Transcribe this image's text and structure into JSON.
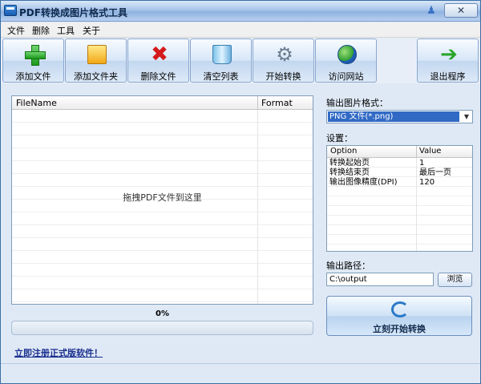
{
  "window": {
    "title": "PDF转换成图片格式工具",
    "close_label": "✕"
  },
  "menu": [
    {
      "label": "文件"
    },
    {
      "label": "删除"
    },
    {
      "label": "工具"
    },
    {
      "label": "关于"
    }
  ],
  "toolbar": {
    "add_file": "添加文件",
    "add_folder": "添加文件夹",
    "delete_file": "删除文件",
    "clear_list": "清空列表",
    "start_convert": "开始转换",
    "visit_site": "访问网站",
    "exit": "退出程序"
  },
  "file_list": {
    "col_filename": "FileName",
    "col_format": "Format",
    "drop_hint": "拖拽PDF文件到这里"
  },
  "progress": {
    "label": "0%",
    "value": 0
  },
  "register_link": "立即注册正式版软件！",
  "output_format": {
    "label": "输出图片格式：",
    "selected": "PNG 文件(*.png)"
  },
  "settings": {
    "label": "设置：",
    "col_option": "Option",
    "col_value": "Value",
    "rows": [
      {
        "option": "转换起始页",
        "value": "1"
      },
      {
        "option": "转换结束页",
        "value": "最后一页"
      },
      {
        "option": "输出图像精度(DPI)",
        "value": "120"
      }
    ]
  },
  "output_path": {
    "label": "输出路径：",
    "value": "C:\\output",
    "browse_label": "浏览"
  },
  "convert_button": "立刻开始转换",
  "icons": {
    "app": "app-icon",
    "add_file": "plus-icon",
    "add_folder": "folder-icon",
    "delete_file": "red-x-icon",
    "clear_list": "recycle-bin-icon",
    "start_convert": "gears-icon",
    "visit_site": "globe-icon",
    "exit": "green-arrow-icon",
    "convert": "refresh-icon"
  }
}
